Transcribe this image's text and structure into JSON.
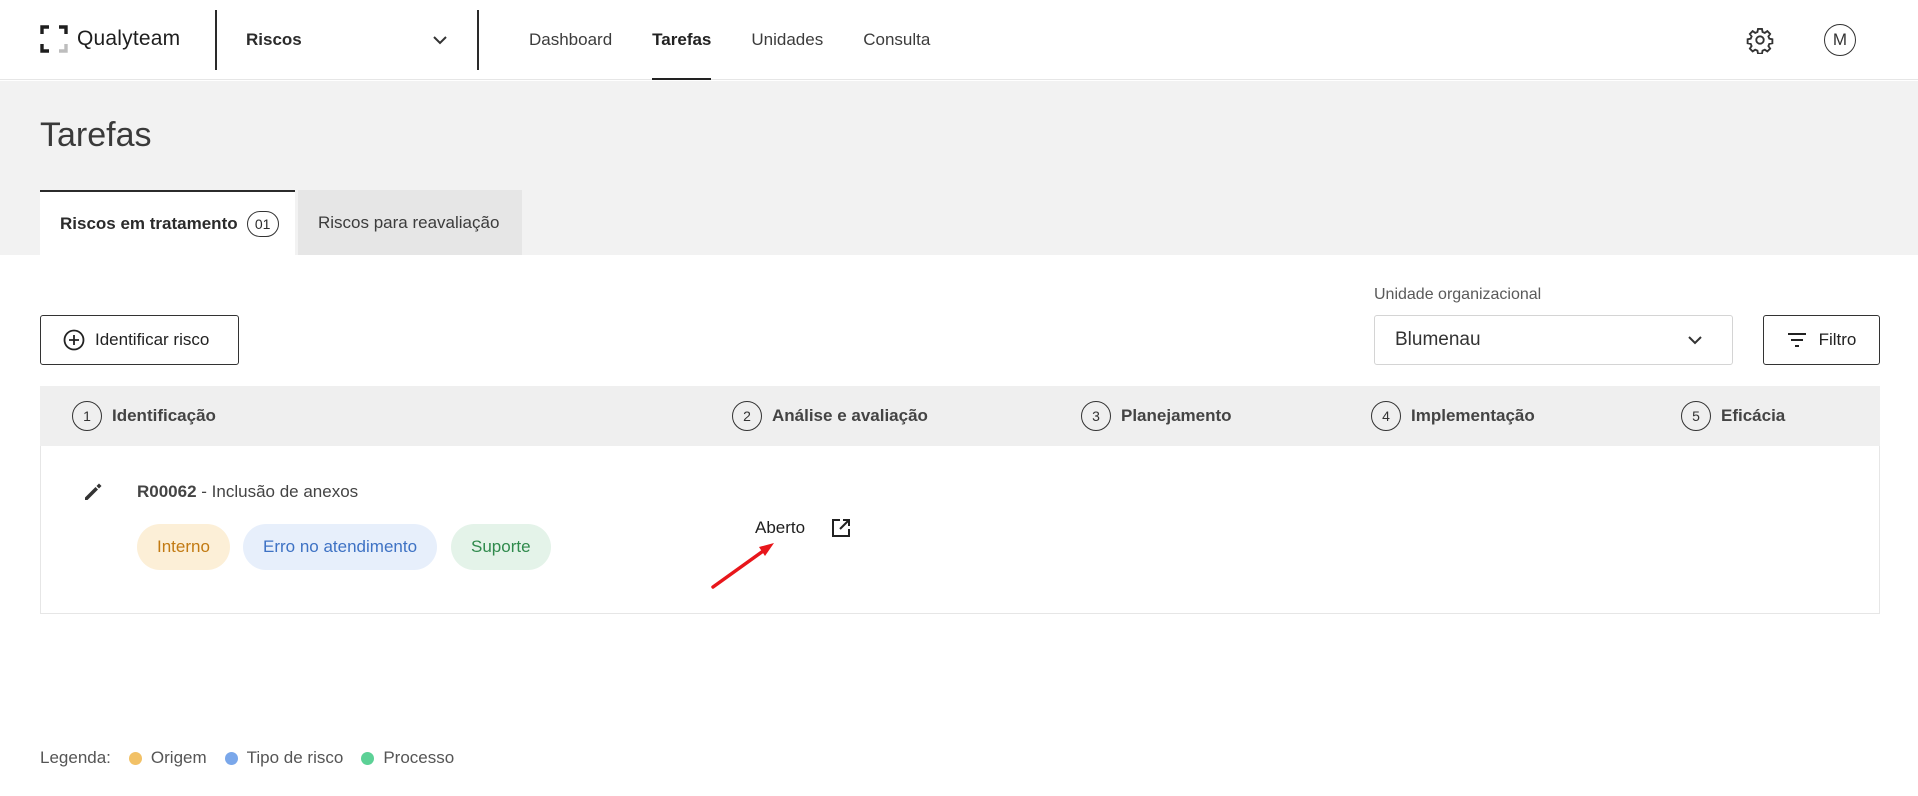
{
  "app": {
    "logo_text": "Qualyteam"
  },
  "module": {
    "selected": "Riscos"
  },
  "nav": {
    "items": [
      "Dashboard",
      "Tarefas",
      "Unidades",
      "Consulta"
    ],
    "active": "Tarefas"
  },
  "user": {
    "avatar_initial": "M"
  },
  "page": {
    "title": "Tarefas"
  },
  "tabs": [
    {
      "label": "Riscos em tratamento",
      "count": "01",
      "active": true
    },
    {
      "label": "Riscos para reavaliação",
      "active": false
    }
  ],
  "toolbar": {
    "identify_label": "Identificar risco",
    "unit_label": "Unidade organizacional",
    "unit_value": "Blumenau",
    "filter_label": "Filtro"
  },
  "steps": [
    {
      "num": "1",
      "label": "Identificação"
    },
    {
      "num": "2",
      "label": "Análise e avaliação"
    },
    {
      "num": "3",
      "label": "Planejamento"
    },
    {
      "num": "4",
      "label": "Implementação"
    },
    {
      "num": "5",
      "label": "Eficácia"
    }
  ],
  "risk": {
    "code": "R00062",
    "separator": " - ",
    "name": "Inclusão de anexos",
    "tags": {
      "origem": "Interno",
      "tipo": "Erro no atendimento",
      "processo": "Suporte"
    },
    "status": "Aberto"
  },
  "legend": {
    "label": "Legenda:",
    "items": [
      {
        "label": "Origem",
        "color": "#f2c166"
      },
      {
        "label": "Tipo de risco",
        "color": "#7aa7ea"
      },
      {
        "label": "Processo",
        "color": "#5cd196"
      }
    ]
  },
  "colors": {
    "arrow": "#e8161b",
    "text": "#2b2b2b"
  }
}
